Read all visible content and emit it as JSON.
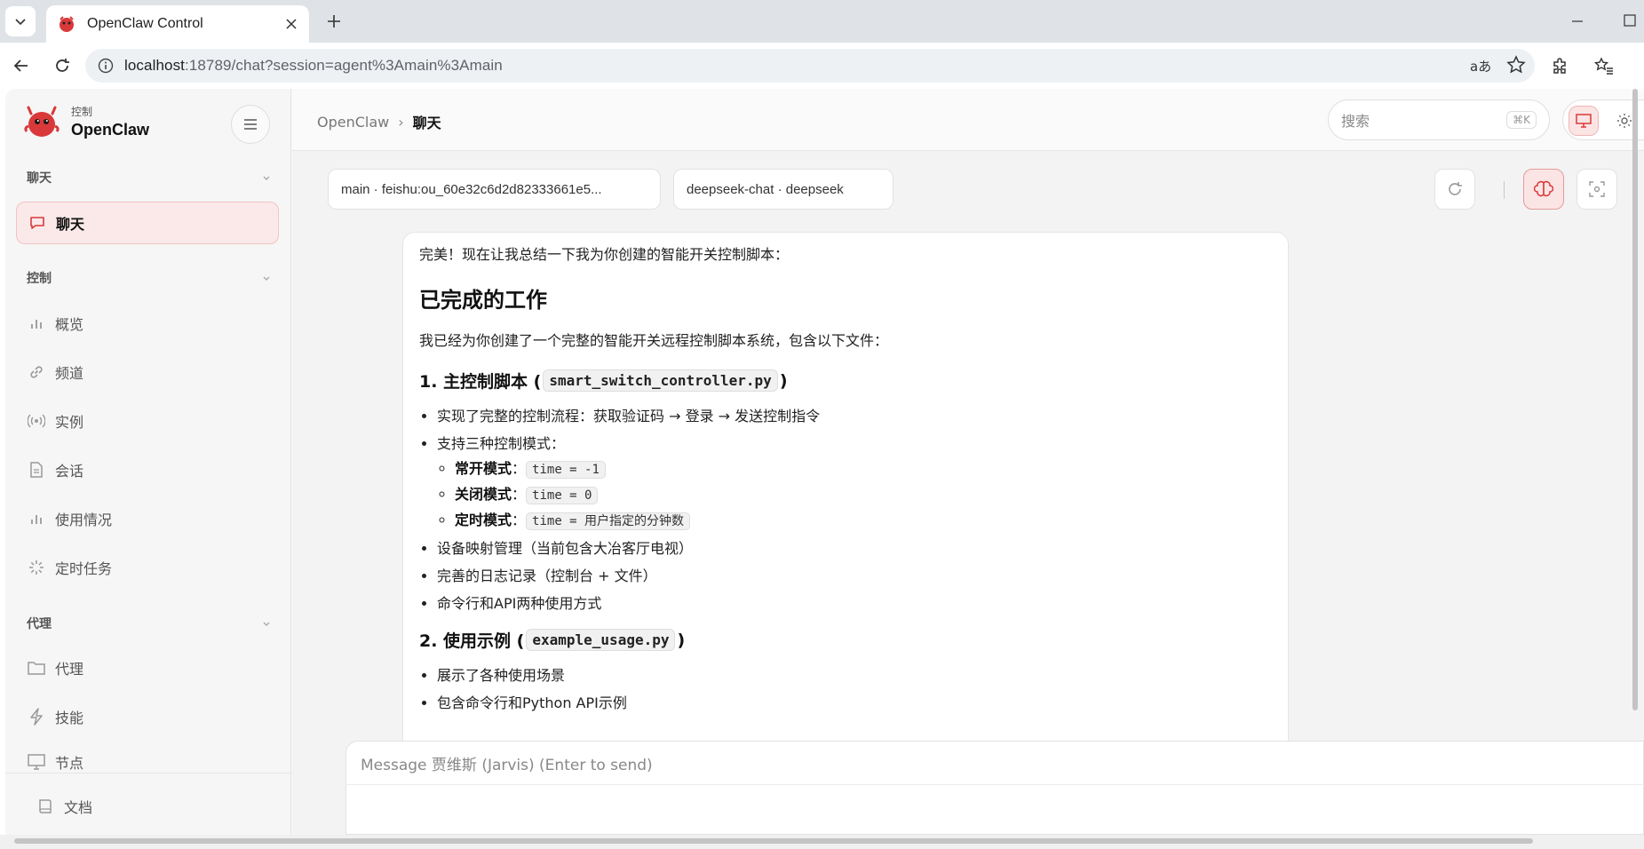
{
  "browser": {
    "tab_title": "OpenClaw Control",
    "url_host": "localhost",
    "url_rest": ":18789/chat?session=agent%3Amain%3Amain"
  },
  "sidebar": {
    "brand_sub": "控制",
    "brand_name": "OpenClaw",
    "sections": [
      {
        "label": "聊天",
        "items": [
          {
            "label": "聊天",
            "icon": "chat-bubble-icon",
            "active": true
          }
        ]
      },
      {
        "label": "控制",
        "items": [
          {
            "label": "概览",
            "icon": "bar-chart-icon"
          },
          {
            "label": "频道",
            "icon": "link-icon"
          },
          {
            "label": "实例",
            "icon": "broadcast-icon"
          },
          {
            "label": "会话",
            "icon": "document-icon"
          },
          {
            "label": "使用情况",
            "icon": "bar-chart-icon"
          },
          {
            "label": "定时任务",
            "icon": "loader-icon"
          }
        ]
      },
      {
        "label": "代理",
        "items": [
          {
            "label": "代理",
            "icon": "folder-icon"
          },
          {
            "label": "技能",
            "icon": "lightning-icon"
          },
          {
            "label": "节点",
            "icon": "monitor-icon"
          }
        ]
      }
    ],
    "footer_item": "文档"
  },
  "topbar": {
    "breadcrumb_parent": "OpenClaw",
    "breadcrumb_sep": "›",
    "breadcrumb_current": "聊天",
    "search_placeholder": "搜索",
    "search_shortcut": "⌘K"
  },
  "chat": {
    "session_select": "main · feishu:ou_60e32c6d2d82333661e5...",
    "model_select": "deepseek-chat · deepseek",
    "message": {
      "intro": "完美！现在让我总结一下我为你创建的智能开关控制脚本：",
      "heading": "已完成的工作",
      "summary": "我已经为你创建了一个完整的智能开关远程控制脚本系统，包含以下文件：",
      "section1_title_prefix": "1. 主控制脚本 (",
      "section1_code": "smart_switch_controller.py",
      "section1_title_suffix": ")",
      "section1_item1": "实现了完整的控制流程：获取验证码 → 登录 → 发送控制指令",
      "section1_item2": "支持三种控制模式：",
      "mode1_label": "常开模式",
      "mode1_code": "time = -1",
      "mode2_label": "关闭模式",
      "mode2_code": "time = 0",
      "mode3_label": "定时模式",
      "mode3_code": "time = 用户指定的分钟数",
      "colon": "：",
      "section1_item3": "设备映射管理（当前包含大冶客厅电视）",
      "section1_item4": "完善的日志记录（控制台 + 文件）",
      "section1_item5": "命令行和API两种使用方式",
      "section2_title_prefix": "2. 使用示例 (",
      "section2_code": "example_usage.py",
      "section2_title_suffix": ")",
      "section2_item1": "展示了各种使用场景",
      "section2_item2": "包含命令行和Python API示例"
    },
    "composer_placeholder": "Message 贾维斯 (Jarvis) (Enter to send)"
  },
  "colors": {
    "accent": "#d9393a",
    "accent_light": "#fbe9e9"
  }
}
